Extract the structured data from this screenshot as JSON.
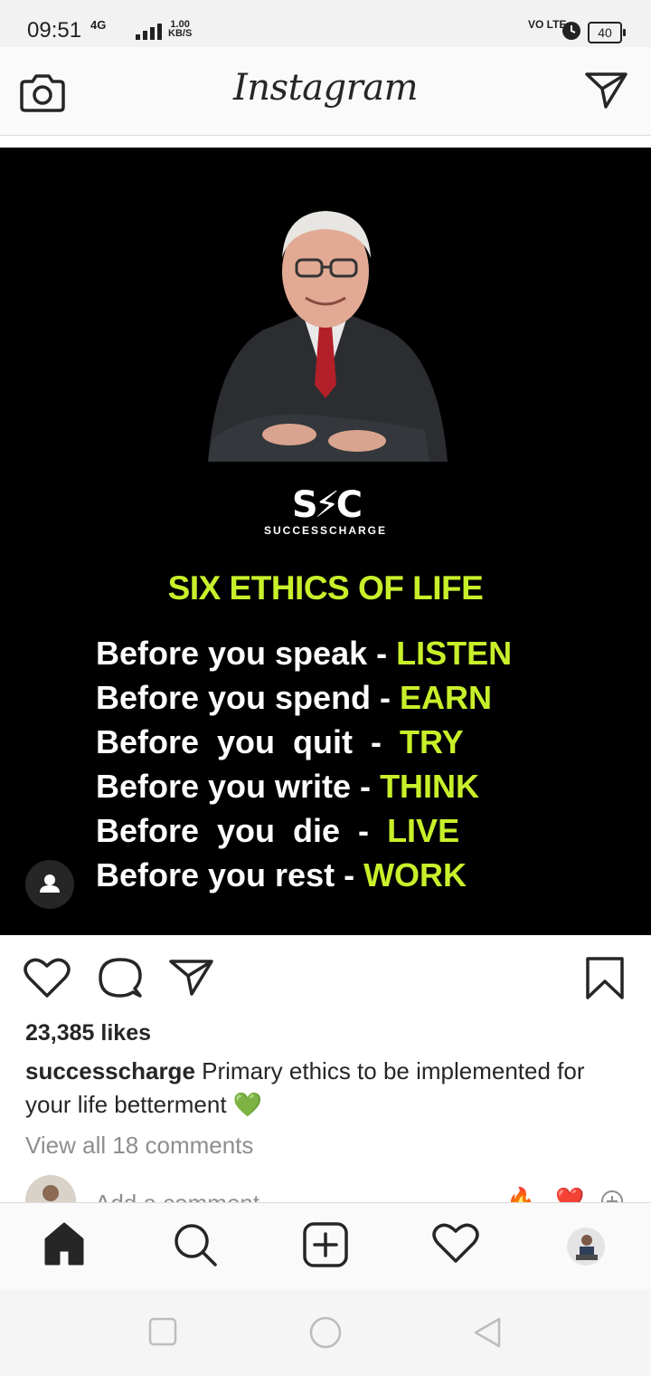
{
  "status_bar": {
    "time": "09:51",
    "network": "4G",
    "speed_value": "1.00",
    "speed_unit": "KB/S",
    "volte": "VO LTE",
    "battery": "40"
  },
  "header": {
    "logo": "Instagram",
    "camera_icon": "camera-icon",
    "direct_icon": "paper-plane-icon"
  },
  "post": {
    "brand_mark": "S⚡C",
    "brand_name": "SUCCESSCHARGE",
    "heading": "SIX ETHICS OF LIFE",
    "ethics": [
      {
        "prefix": "Before you speak - ",
        "word": "LISTEN"
      },
      {
        "prefix": "Before you spend - ",
        "word": "EARN"
      },
      {
        "prefix": "Before  you  quit  -  ",
        "word": "TRY"
      },
      {
        "prefix": "Before you write - ",
        "word": "THINK"
      },
      {
        "prefix": "Before  you  die  -  ",
        "word": "LIVE"
      },
      {
        "prefix": "Before you rest - ",
        "word": "WORK"
      }
    ],
    "accent_color": "#c8f02a",
    "likes": "23,385 likes",
    "caption_user": "successcharge",
    "caption_text": " Primary ethics to be implemented for your life betterment 💚",
    "view_comments": "View all 18 comments",
    "comment_placeholder": "Add a comment...",
    "quick_reactions": [
      "🔥",
      "❤️"
    ]
  },
  "bottom_nav": {
    "items": [
      "home-icon",
      "search-icon",
      "new-post-icon",
      "activity-icon",
      "profile-avatar"
    ]
  },
  "system_nav": {
    "items": [
      "recents-button",
      "home-button",
      "back-button"
    ]
  }
}
